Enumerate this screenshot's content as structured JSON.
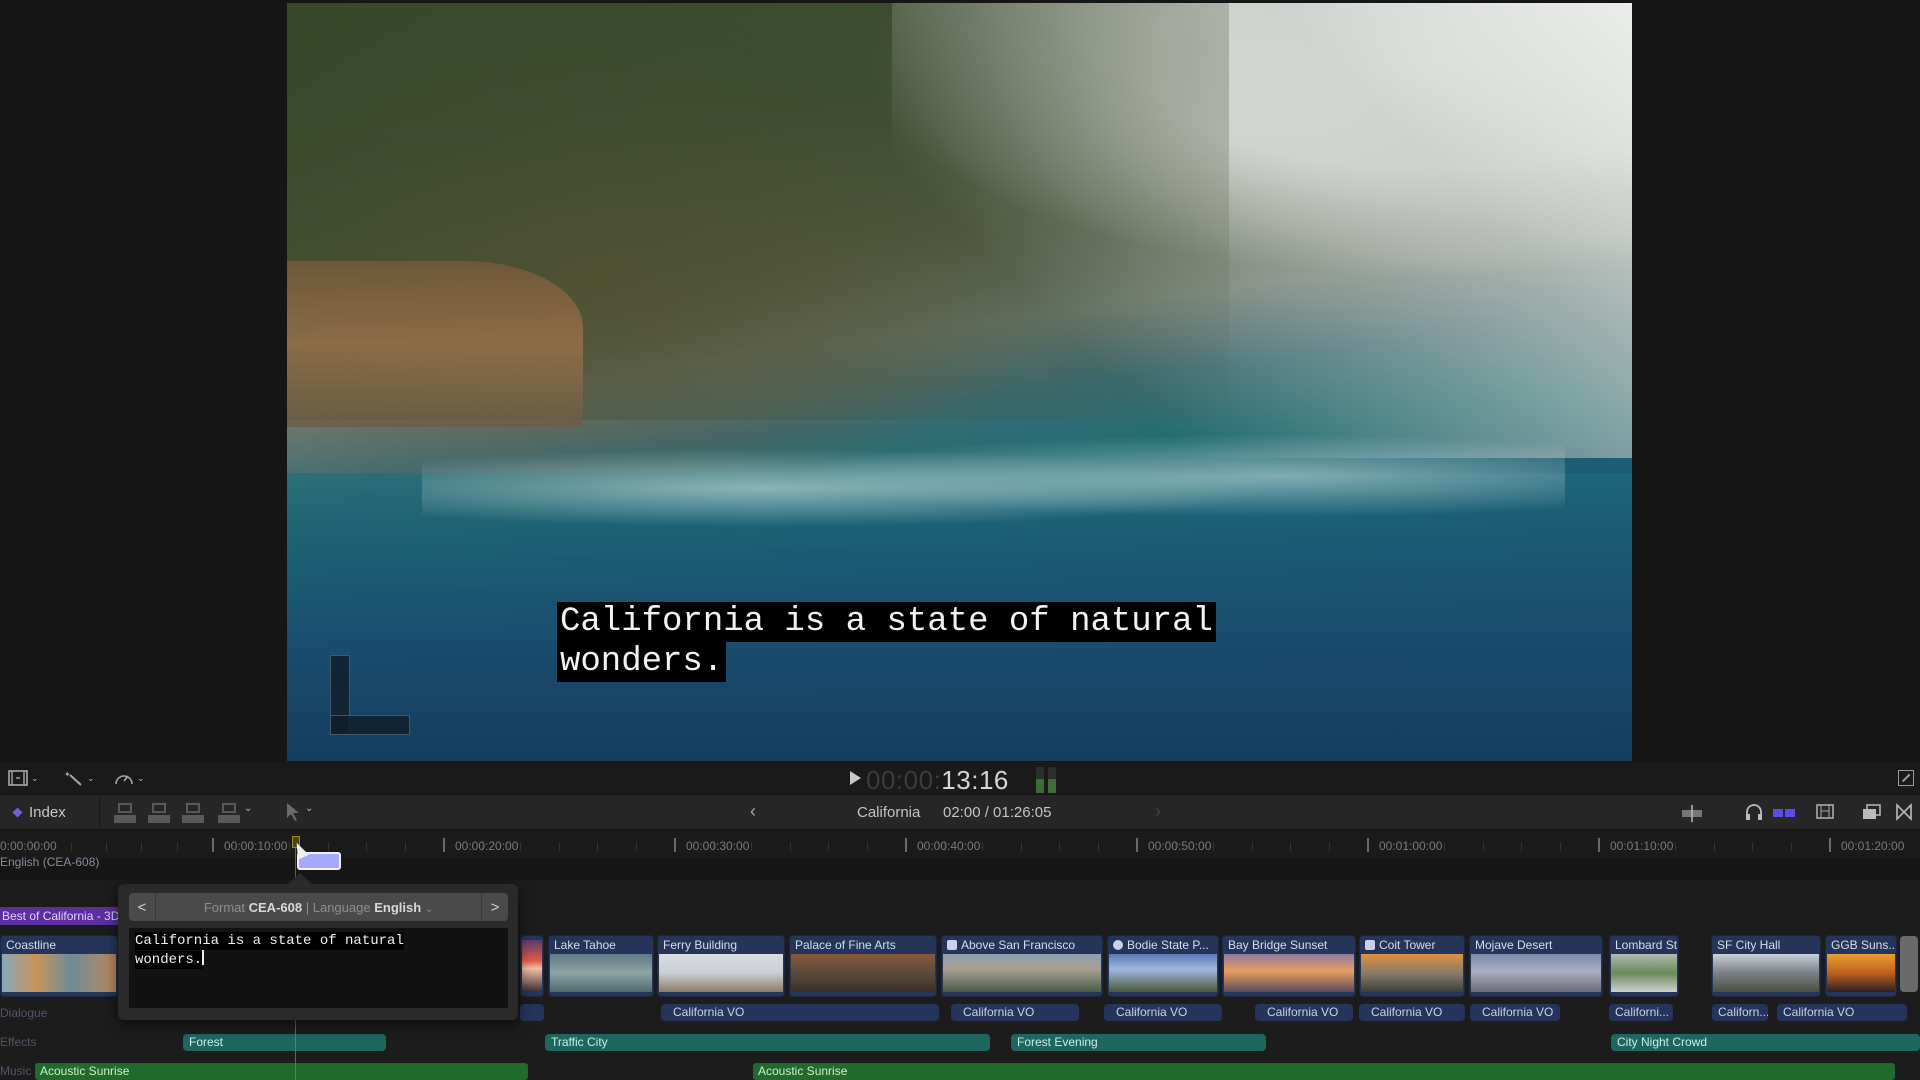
{
  "viewer": {
    "caption_lines": [
      "California is a state of natural",
      "wonders."
    ]
  },
  "viewer_controls": {
    "timecode_dim": "00:00:",
    "timecode_bright": "13:16",
    "audio_levels": [
      0.55,
      0.55
    ],
    "icons": [
      "viewer-options-icon",
      "enhance-wand-icon",
      "retime-speedometer-icon",
      "fullscreen-icon"
    ]
  },
  "toolbar": {
    "index_label": "Index",
    "project_title": "California",
    "project_duration": "02:00 / 01:26:05",
    "accent_color": "#6b5fdc"
  },
  "ruler": {
    "ticks": [
      "0:00:00:00",
      "00:00:10:00",
      "00:00:20:00",
      "00:00:30:00",
      "00:00:40:00",
      "00:00:50:00",
      "00:01:00:00",
      "00:01:10:00",
      "00:01:20:00"
    ]
  },
  "caption_lane": {
    "label": "English (CEA-608)"
  },
  "caption_editor": {
    "format_label": "Format",
    "format_value": "CEA-608",
    "separator": "|",
    "language_label": "Language",
    "language_value": "English",
    "text_lines": [
      "California is a state of natural",
      "wonders."
    ]
  },
  "timeline": {
    "storyline_label": "Best of California - 3D",
    "lane_labels": {
      "dialogue": "Dialogue",
      "effects": "Effects",
      "music": "Music"
    },
    "clips": [
      {
        "title": "Coastline",
        "icon": ""
      },
      {
        "title": "",
        "icon": ""
      },
      {
        "title": "Lake Tahoe",
        "icon": ""
      },
      {
        "title": "Ferry Building",
        "icon": ""
      },
      {
        "title": "Palace of Fine Arts",
        "icon": ""
      },
      {
        "title": "Above San Francisco",
        "icon": "compound-clip-icon"
      },
      {
        "title": "Bodie State P...",
        "icon": "reel-icon"
      },
      {
        "title": "Bay Bridge Sunset",
        "icon": ""
      },
      {
        "title": "Coit Tower",
        "icon": "compound-clip-icon"
      },
      {
        "title": "Mojave Desert",
        "icon": ""
      },
      {
        "title": "Lombard St.",
        "icon": ""
      },
      {
        "title": "SF City Hall",
        "icon": ""
      },
      {
        "title": "GGB Suns...",
        "icon": ""
      }
    ],
    "dialogue_clips": [
      "California VO",
      "California VO",
      "California VO",
      "California VO",
      "California VO",
      "California VO",
      "Californi...",
      "Californ...",
      "California VO"
    ],
    "effects_clips": [
      "Forest",
      "Traffic City",
      "Forest Evening",
      "City Night Crowd"
    ],
    "music_clips": [
      "Acoustic Sunrise",
      "Acoustic Sunrise"
    ]
  }
}
